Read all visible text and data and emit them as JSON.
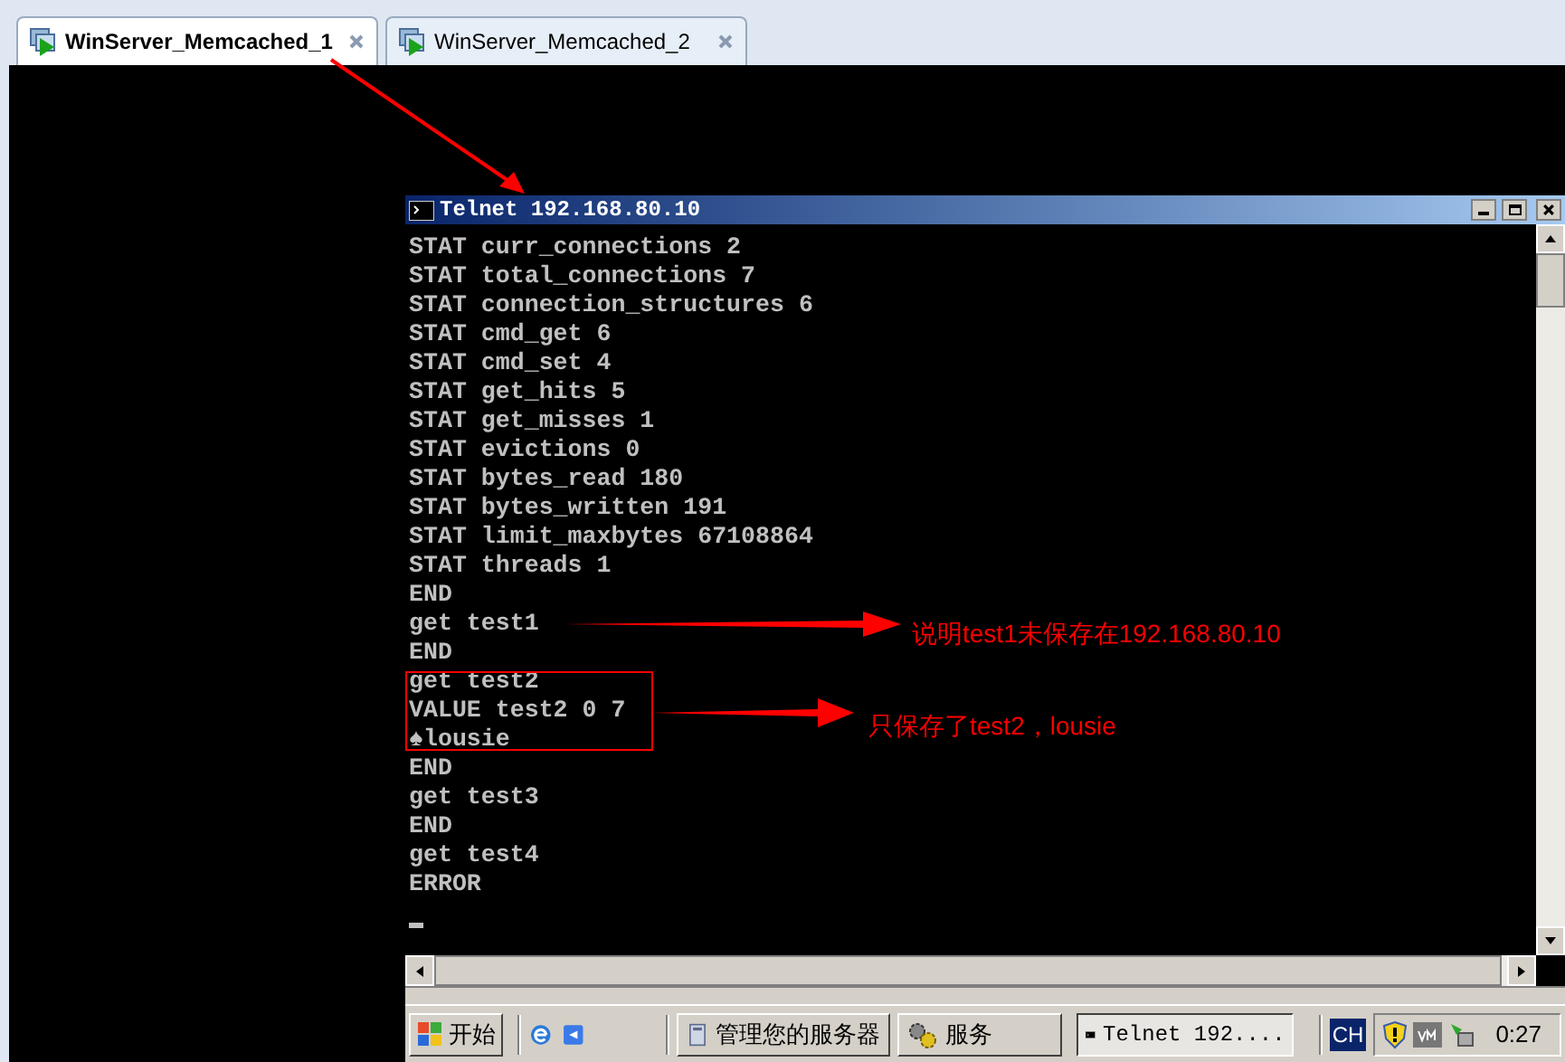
{
  "tabs": [
    {
      "label": "WinServer_Memcached_1",
      "selected": true
    },
    {
      "label": "WinServer_Memcached_2",
      "selected": false
    }
  ],
  "telnet": {
    "title": "Telnet 192.168.80.10",
    "lines": [
      "STAT curr_connections 2",
      "STAT total_connections 7",
      "STAT connection_structures 6",
      "STAT cmd_get 6",
      "STAT cmd_set 4",
      "STAT get_hits 5",
      "STAT get_misses 1",
      "STAT evictions 0",
      "STAT bytes_read 180",
      "STAT bytes_written 191",
      "STAT limit_maxbytes 67108864",
      "STAT threads 1",
      "END",
      "get test1",
      "END",
      "get test2",
      "VALUE test2 0 7",
      "♠lousie",
      "END",
      "get test3",
      "END",
      "get test4",
      "ERROR"
    ]
  },
  "annotations": [
    {
      "text": "说明test1未保存在192.168.80.10"
    },
    {
      "text": "只保存了test2，lousie"
    }
  ],
  "taskbar": {
    "start": "开始",
    "buttons": [
      {
        "label": "管理您的服务器",
        "kind": "server",
        "selected": false
      },
      {
        "label": "服务",
        "kind": "gears",
        "selected": false
      },
      {
        "label": "Telnet 192....",
        "kind": "console",
        "selected": true
      }
    ],
    "ime": "CH",
    "clock": "0:27"
  }
}
